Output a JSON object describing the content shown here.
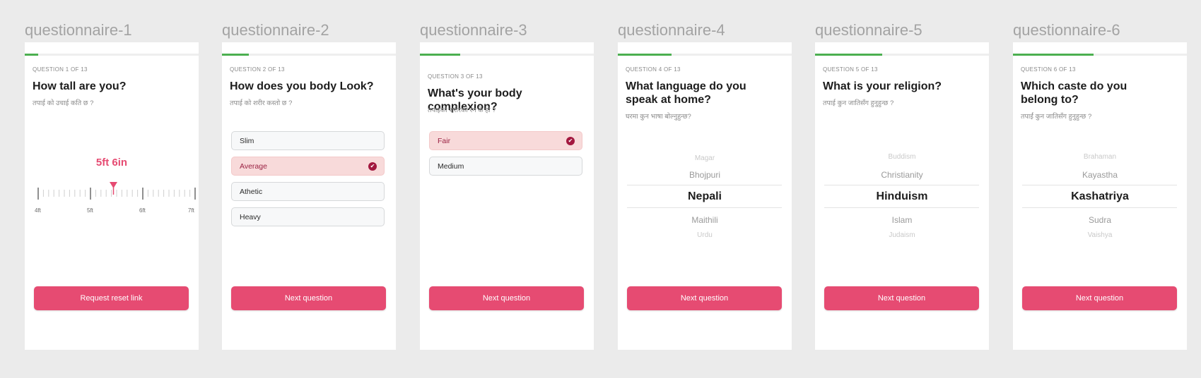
{
  "frames": [
    {
      "label": "questionnaire-1",
      "question_number": "QUESTION 1 OF 13",
      "title_lines": [
        "How tall are you?"
      ],
      "subtitle": "तपाई को उचाई कति छ ?",
      "progress": 0.077,
      "height_value": "5ft 6in",
      "ruler_labels": [
        "4ft",
        "5ft",
        "6ft",
        "7ft"
      ],
      "button_label": "Request reset link"
    },
    {
      "label": "questionnaire-2",
      "question_number": "QUESTION 2 OF 13",
      "title_lines": [
        "How does you body Look?"
      ],
      "subtitle": "तपाई को शरीर कस्तो छ ?",
      "progress": 0.154,
      "options": [
        {
          "label": "Slim",
          "selected": false
        },
        {
          "label": "Average",
          "selected": true
        },
        {
          "label": "Athetic",
          "selected": false
        },
        {
          "label": "Heavy",
          "selected": false
        }
      ],
      "button_label": "Next question"
    },
    {
      "label": "questionnaire-3",
      "question_number": "QUESTION 3 OF 13",
      "title_lines": [
        "What's your body complexion?"
      ],
      "subtitle": "तपाइको शरीरको रंग के हो ?",
      "progress": 0.231,
      "options": [
        {
          "label": "Fair",
          "selected": true
        },
        {
          "label": "Medium",
          "selected": false
        }
      ],
      "button_label": "Next question"
    },
    {
      "label": "questionnaire-4",
      "question_number": "QUESTION 4 OF 13",
      "title_lines": [
        "What language do you",
        "speak at home?"
      ],
      "subtitle": "घरमा कुन भाषा बोल्नुहुन्छ?",
      "progress": 0.308,
      "picker": {
        "far_above": "Magar",
        "above": "Bhojpuri",
        "selected": "Nepali",
        "below": "Maithili",
        "far_below": "Urdu"
      },
      "button_label": "Next question"
    },
    {
      "label": "questionnaire-5",
      "question_number": "QUESTION 5 OF 13",
      "title_lines": [
        "What is your religion?"
      ],
      "subtitle": "तपाई कुन जातिसँग हुनुहुन्छ ?",
      "progress": 0.385,
      "picker": {
        "far_above": "Buddism",
        "above": "Christianity",
        "selected": "Hinduism",
        "below": "Islam",
        "far_below": "Judaism"
      },
      "button_label": "Next question"
    },
    {
      "label": "questionnaire-6",
      "question_number": "QUESTION 6 OF 13",
      "title_lines": [
        "Which caste do you",
        "belong to?"
      ],
      "subtitle": "तपाईं कुन जातिसँग हुनुहुन्छ ?",
      "progress": 0.462,
      "picker": {
        "far_above": "Brahaman",
        "above": "Kayastha",
        "selected": "Kashatriya",
        "below": "Sudra",
        "far_below": "Vaishya"
      },
      "button_label": "Next question"
    }
  ],
  "colors": {
    "accent": "#e64b72",
    "progress": "#4caf50",
    "selected_bg": "#f8dada",
    "check": "#a3183f"
  },
  "icons": {
    "selected_option": "check-circle-icon",
    "ruler_pointer": "triangle-pointer-icon"
  }
}
